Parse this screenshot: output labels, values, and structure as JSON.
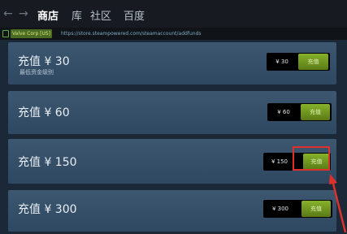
{
  "nav": {
    "back_glyph": "←",
    "forward_glyph": "→",
    "tabs": [
      {
        "label": "商店",
        "active": true
      },
      {
        "label": "库",
        "active": false
      },
      {
        "label": "社区",
        "active": false
      },
      {
        "label": "百度",
        "active": false
      }
    ]
  },
  "urlbar": {
    "cert_label": "Valve Corp [US]",
    "url": "https://store.steampowered.com/steamaccount/addfunds"
  },
  "cards": [
    {
      "title": "充值 ¥ 30",
      "subtitle": "最低资金级别",
      "price": "¥ 30",
      "button_label": "充值"
    },
    {
      "title": "充值 ¥ 60",
      "subtitle": "",
      "price": "¥ 60",
      "button_label": "充值"
    },
    {
      "title": "充值 ¥ 150",
      "subtitle": "",
      "price": "¥ 150",
      "button_label": "充值"
    },
    {
      "title": "充值 ¥ 300",
      "subtitle": "",
      "price": "¥ 300",
      "button_label": "充值"
    }
  ],
  "colors": {
    "highlight": "#e0302a",
    "accent_green": "#86b22b",
    "background": "#1b2838"
  },
  "icons": [
    "back-arrow-icon",
    "forward-arrow-icon",
    "lock-icon",
    "pointer-arrow-icon"
  ]
}
